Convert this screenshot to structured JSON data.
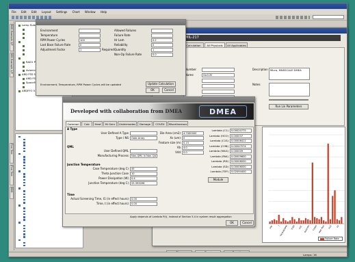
{
  "main_window": {
    "title": "",
    "menu": [
      "File",
      "Edit",
      "Edit",
      "Layout",
      "Settings",
      "Chart",
      "Window",
      "Help"
    ],
    "search_value": ""
  },
  "left_strip": {
    "tabs": [
      "RBD Example 2/P",
      "SBS Example 2/P",
      "Find Tree",
      "Find Tree",
      "RBD"
    ]
  },
  "upper_tree": {
    "rows": [
      "Lamp Subsystem",
      "",
      "",
      "",
      "",
      "",
      "",
      "",
      "",
      "RAD1 PSS (E 001 PS)",
      "",
      "Avionics Systems",
      "ARD FSS Subsystem",
      "ARD FSS Subsystem",
      "SpaceFed Systems",
      "",
      "ARDFFO 5 Subsystem"
    ]
  },
  "lower_tree": {
    "rows": [
      "",
      "",
      "",
      "",
      "",
      "",
      "",
      "",
      "",
      "",
      "",
      "",
      "",
      "",
      "",
      "",
      "",
      "",
      "",
      "",
      "",
      "",
      "",
      "",
      "",
      "",
      "",
      "",
      "",
      "",
      "",
      "",
      "",
      "",
      "",
      "",
      "",
      "",
      ""
    ]
  },
  "bottom_tabs": [
    "Diag",
    "Chart",
    "Result"
  ],
  "status_bar": {
    "left": "",
    "mid": "",
    "right": "Lamps: 16"
  },
  "mil_window": {
    "title": "",
    "name": "MIL-217",
    "tabs": [
      "Calculation",
      "All Physicals",
      "All Applicables"
    ],
    "section": "",
    "fields": {
      "number_label": "Number",
      "number_value": "",
      "name_label": "Name",
      "name_value": "GLO-M",
      "description_label": "Description",
      "description_value": "Micro, MNSSCALE DMEA",
      "notes_label": "Notes",
      "part_label": "Part",
      "part_value": "Micro, MNSSCALE DMEA"
    },
    "buttons": [
      "",
      "Run Lin Parameters",
      "Analyze"
    ],
    "plot_button": "Apply",
    "legend_label": "Failure Rate",
    "x_ticks": [
      "FRC",
      "7",
      "FRCB1B/DM6",
      "TCB6",
      "DSC",
      "B2GCOS",
      "T1009",
      "MKF Mail",
      "FILE",
      "FR"
    ],
    "chart_title": ""
  },
  "prop_window": {
    "title": "",
    "fields": [
      {
        "label": "Environment",
        "value": ""
      },
      {
        "label": "Temperature",
        "value": ""
      },
      {
        "label": "RPM Power Cycles",
        "value": "100"
      },
      {
        "label": "Last Base Failure Rate",
        "value": "0"
      },
      {
        "label": "Adjustment Factor",
        "value": "1"
      }
    ],
    "required": "Required",
    "right_fields": [
      {
        "label": "Allowed Failures",
        "value": ""
      },
      {
        "label": "Failure Rate",
        "value": ""
      },
      {
        "label": "Hr Lam",
        "value": "0.2"
      },
      {
        "label": "Reliability",
        "value": "0"
      },
      {
        "label": "Quantity",
        "value": "1"
      },
      {
        "label": "Non-Op Failure Rate",
        "value": "0.0"
      }
    ],
    "note": "Environment, Temperature, RPM Power Cycles will be updated",
    "buttons": {
      "update": "Update Calculation",
      "ok": "OK",
      "cancel": "Cancel"
    }
  },
  "dmea_window": {
    "title": "",
    "banner_text": "Developed with collaboration from DMEA",
    "logo": "DMEA",
    "tabs": [
      "Common",
      "Calc",
      "Heat",
      "Ht Genr",
      "Undermodes",
      "Damage",
      "COVEX",
      "Miscellaneous"
    ],
    "sections": [
      "A Type",
      "QML",
      "Junction Temperature",
      "Time"
    ],
    "left_fields": [
      {
        "label": "User Defined A Type",
        "value": ""
      },
      {
        "label": "Type / NS",
        "value": "Gate Array"
      },
      {
        "label": "User Defined QML",
        "value": ""
      },
      {
        "label": "Manufacturing Process",
        "value": "Non-QML In Non-QA"
      },
      {
        "label": "Case Temperature (deg C)",
        "value": "45"
      },
      {
        "label": "Theta Junction Case",
        "value": "10"
      },
      {
        "label": "Power Dissipation (W)",
        "value": "0.4"
      },
      {
        "label": "Junction Temperature (deg C)",
        "value": "55.393096"
      },
      {
        "label": "Actual Screening Time, t1 (in effect hours)",
        "value": "0.00"
      },
      {
        "label": "Time, t (in effect hours)",
        "value": "0.00"
      }
    ],
    "mid_fields": [
      {
        "label": "Die Area (cm2)",
        "value": "4.7000000"
      },
      {
        "label": "Xs (um)",
        "value": "0"
      },
      {
        "label": "Feature size (microns)",
        "value": "0.15"
      },
      {
        "label": "Vb",
        "value": "4.0"
      },
      {
        "label": "Vdd",
        "value": "0.0"
      }
    ],
    "lambda_fields": [
      {
        "label": "Lambda (C1)",
        "value": "0.00020775"
      },
      {
        "label": "Lambda (HCO)",
        "value": "0.000037"
      },
      {
        "label": "Lambda (C1S)",
        "value": "0.00006411"
      },
      {
        "label": "Lambda (CHN)",
        "value": "0.00047074"
      },
      {
        "label": "Lambda (MAG)",
        "value": "0.000009"
      },
      {
        "label": "Lambda (PAK)",
        "value": "0.00009600"
      },
      {
        "label": "Lambda (RD)",
        "value": "0.00006000"
      },
      {
        "label": "Lambda (SD)",
        "value": "0.00006000"
      },
      {
        "label": "Lambda (TEP)",
        "value": "0.02094400"
      }
    ],
    "module_btn": "Module",
    "footer_note": "Apply depends of Lambda P(t), instead of Section 5.4 in system result aggregation",
    "ok": "OK",
    "cancel": "Cancel"
  },
  "chart_data": {
    "type": "bar",
    "categories": [
      "FRC",
      "7",
      "FRCB1B/DM6",
      "TCB6",
      "DSC",
      "B2GCOS",
      "T1009",
      "MKF Mail",
      "FILE",
      "FR"
    ],
    "series": [
      {
        "name": "Failure Rate",
        "values": [
          2,
          3,
          4,
          3,
          8,
          2,
          5,
          3,
          2,
          3,
          6,
          4,
          2,
          5,
          3,
          3,
          5,
          4,
          3,
          55,
          6,
          5,
          4,
          6,
          3,
          2,
          72,
          4,
          25,
          30,
          4,
          3,
          6
        ]
      }
    ],
    "ylim": [
      0,
      80
    ],
    "color": "#c8432a",
    "legend": "bottom-right"
  }
}
